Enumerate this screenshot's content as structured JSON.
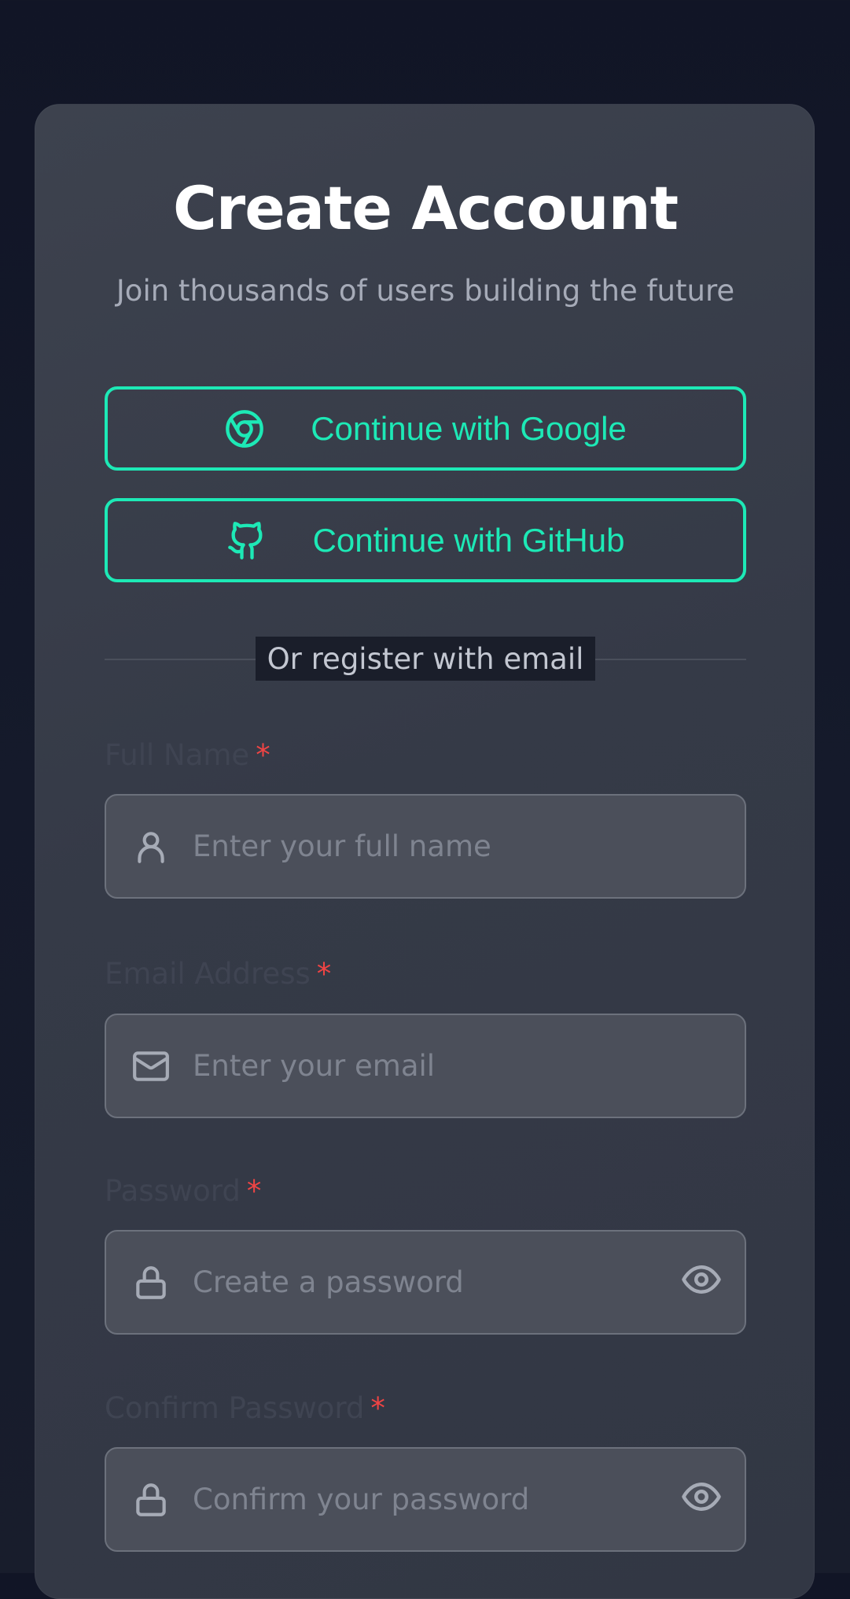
{
  "header": {
    "title": "Create Account",
    "subtitle": "Join thousands of users building the future"
  },
  "social": {
    "google_label": "Continue with Google",
    "github_label": "Continue with GitHub"
  },
  "divider": {
    "label": "Or register with email"
  },
  "form": {
    "required_marker": "*",
    "full_name": {
      "label": "Full Name",
      "placeholder": "Enter your full name",
      "icon": "user-icon"
    },
    "email": {
      "label": "Email Address",
      "placeholder": "Enter your email",
      "icon": "mail-icon"
    },
    "password": {
      "label": "Password",
      "placeholder": "Create a password",
      "icon": "lock-icon"
    },
    "confirm_password": {
      "label": "Confirm Password",
      "placeholder": "Confirm your password",
      "icon": "lock-icon"
    }
  },
  "colors": {
    "accent": "#1de9b6",
    "required": "#ef4444",
    "background": "#111526",
    "card": "#3a3f4b"
  }
}
